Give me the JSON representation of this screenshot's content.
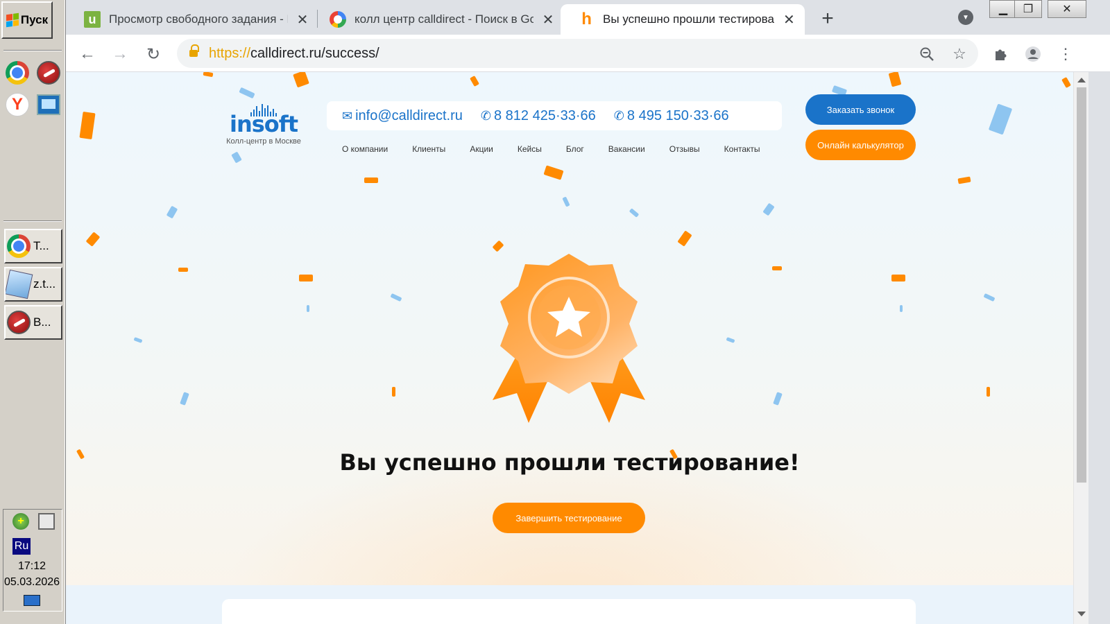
{
  "taskbar": {
    "start_label": "Пуск",
    "tasks": [
      {
        "label": "Т...",
        "icon": "chrome-icon"
      },
      {
        "label": "z.t...",
        "icon": "notepad-icon"
      },
      {
        "label": "B...",
        "icon": "comodo-dragon-icon"
      }
    ],
    "language": "Ru",
    "time": "17:12",
    "date": "05.03.2026"
  },
  "browser": {
    "tabs": [
      {
        "title": "Просмотр свободного задания - В",
        "favicon": "u-favicon",
        "active": false
      },
      {
        "title": "колл центр calldirect - Поиск в Goo",
        "favicon": "google-favicon",
        "active": false
      },
      {
        "title": "Вы успешно прошли тестирование",
        "favicon": "h-favicon",
        "active": true
      }
    ],
    "url_scheme": "https://",
    "url_rest": "calldirect.ru/success/"
  },
  "site": {
    "logo_text": "insoft",
    "logo_tagline": "Колл-центр в Москве",
    "email": "info@calldirect.ru",
    "phone1": "8 812 425·33·66",
    "phone2": "8 495 150·33·66",
    "nav": [
      "О компании",
      "Клиенты",
      "Акции",
      "Кейсы",
      "Блог",
      "Вакансии",
      "Отзывы",
      "Контакты"
    ],
    "cta_call": "Заказать звонок",
    "cta_calc": "Онлайн калькулятор",
    "success_title": "Вы успешно прошли тестирование!",
    "finish_button": "Завершить тестирование",
    "colors": {
      "brand_blue": "#1a73c9",
      "accent_orange": "#ff8a00",
      "confetti_blue": "#8ec5f0"
    }
  }
}
